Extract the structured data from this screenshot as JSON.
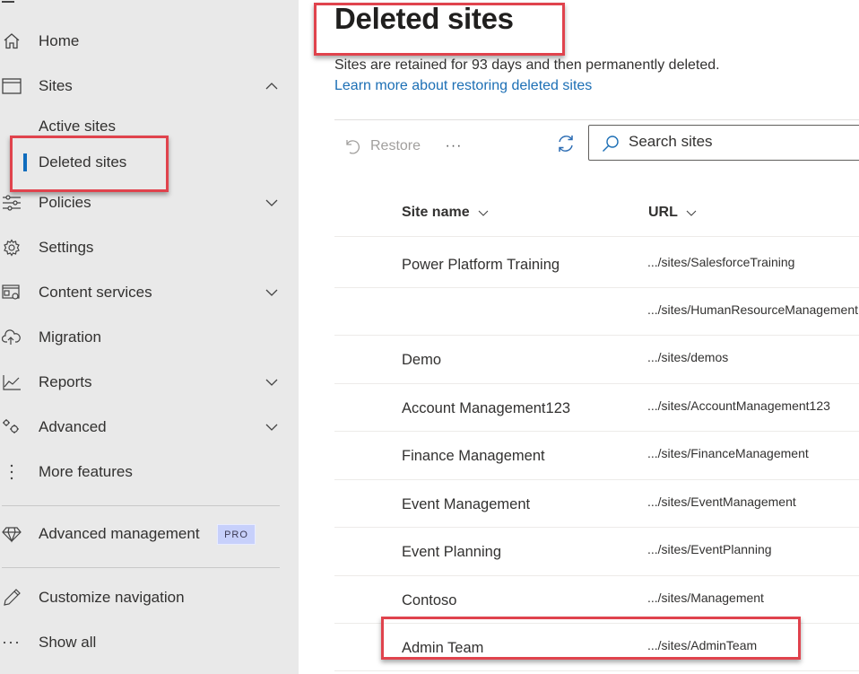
{
  "sidebar": {
    "items": [
      {
        "label": "Home",
        "icon": "home-icon"
      },
      {
        "label": "Sites",
        "icon": "browser-window-icon",
        "chevron": "up"
      },
      {
        "label": "Active sites"
      },
      {
        "label": "Deleted sites",
        "active": true
      },
      {
        "label": "Policies",
        "icon": "sliders-icon",
        "chevron": "down"
      },
      {
        "label": "Settings",
        "icon": "gear-icon"
      },
      {
        "label": "Content services",
        "icon": "content-services-icon",
        "chevron": "down"
      },
      {
        "label": "Migration",
        "icon": "cloud-upload-icon"
      },
      {
        "label": "Reports",
        "icon": "line-chart-icon",
        "chevron": "down"
      },
      {
        "label": "Advanced",
        "icon": "gears-icon",
        "chevron": "down"
      },
      {
        "label": "More features",
        "icon": "vertical-ellipsis-icon"
      },
      {
        "label": "Advanced management",
        "icon": "diamond-icon",
        "badge": "PRO"
      },
      {
        "label": "Customize navigation",
        "icon": "pencil-icon"
      },
      {
        "label": "Show all",
        "icon": "horizontal-ellipsis-icon"
      }
    ]
  },
  "main": {
    "title": "Deleted sites",
    "description": "Sites are retained for 93 days and then permanently deleted.",
    "learn_more": "Learn more about restoring deleted sites",
    "toolbar": {
      "restore_label": "Restore",
      "more_label": "···",
      "search_placeholder": "Search sites"
    },
    "columns": [
      "Site name",
      "URL"
    ],
    "rows": [
      {
        "name": "Power Platform Training",
        "url": ".../sites/SalesforceTraining"
      },
      {
        "name": "",
        "url": ".../sites/HumanResourceManagement"
      },
      {
        "name": "Demo",
        "url": ".../sites/demos"
      },
      {
        "name": "Account Management123",
        "url": ".../sites/AccountManagement123"
      },
      {
        "name": "Finance Management",
        "url": ".../sites/FinanceManagement"
      },
      {
        "name": "Event Management",
        "url": ".../sites/EventManagement"
      },
      {
        "name": "Event Planning",
        "url": ".../sites/EventPlanning"
      },
      {
        "name": "Contoso",
        "url": ".../sites/Management"
      },
      {
        "name": "Admin Team",
        "url": ".../sites/AdminTeam"
      }
    ]
  },
  "colors": {
    "accent": "#0f6cbd",
    "link": "#1c6fb5",
    "highlight": "#e0434d",
    "sidebar_bg": "#e9e9e9",
    "pro_badge": "#c7d0fb"
  }
}
